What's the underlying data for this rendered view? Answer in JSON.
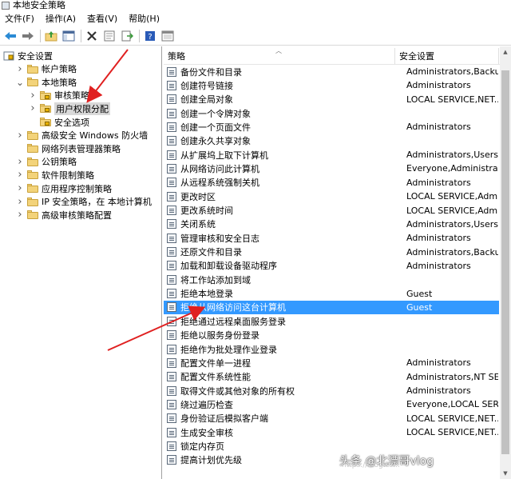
{
  "window": {
    "title": "本地安全策略"
  },
  "menu": [
    {
      "label": "文件(F)"
    },
    {
      "label": "操作(A)"
    },
    {
      "label": "查看(V)"
    },
    {
      "label": "帮助(H)"
    }
  ],
  "toolbar": [
    {
      "icon": "back-arrow-icon"
    },
    {
      "icon": "forward-arrow-icon"
    },
    {
      "icon": "up-folder-icon"
    },
    {
      "icon": "show-tree-icon"
    },
    {
      "icon": "delete-icon"
    },
    {
      "icon": "properties-icon"
    },
    {
      "icon": "export-icon"
    },
    {
      "icon": "help-icon"
    },
    {
      "icon": "console-view-icon"
    }
  ],
  "tree": [
    {
      "label": "安全设置",
      "level": 0,
      "expander": "",
      "selected": false
    },
    {
      "label": "帐户策略",
      "level": 1,
      "expander": ">",
      "selected": false
    },
    {
      "label": "本地策略",
      "level": 1,
      "expander": "v",
      "selected": false
    },
    {
      "label": "审核策略",
      "level": 2,
      "expander": ">",
      "selected": false
    },
    {
      "label": "用户权限分配",
      "level": 2,
      "expander": ">",
      "selected": true
    },
    {
      "label": "安全选项",
      "level": 2,
      "expander": "",
      "selected": false
    },
    {
      "label": "高级安全 Windows 防火墙",
      "level": 1,
      "expander": ">",
      "selected": false
    },
    {
      "label": "网络列表管理器策略",
      "level": 1,
      "expander": "",
      "selected": false
    },
    {
      "label": "公钥策略",
      "level": 1,
      "expander": ">",
      "selected": false
    },
    {
      "label": "软件限制策略",
      "level": 1,
      "expander": ">",
      "selected": false
    },
    {
      "label": "应用程序控制策略",
      "level": 1,
      "expander": ">",
      "selected": false
    },
    {
      "label": "IP 安全策略，在 本地计算机",
      "level": 1,
      "expander": ">",
      "selected": false
    },
    {
      "label": "高级审核策略配置",
      "level": 1,
      "expander": ">",
      "selected": false
    }
  ],
  "list": {
    "columns": [
      "策略",
      "安全设置"
    ],
    "rows": [
      {
        "name": "备份文件和目录",
        "setting": "Administrators,Backu..."
      },
      {
        "name": "创建符号链接",
        "setting": "Administrators"
      },
      {
        "name": "创建全局对象",
        "setting": "LOCAL SERVICE,NET..."
      },
      {
        "name": "创建一个令牌对象",
        "setting": ""
      },
      {
        "name": "创建一个页面文件",
        "setting": "Administrators"
      },
      {
        "name": "创建永久共享对象",
        "setting": ""
      },
      {
        "name": "从扩展坞上取下计算机",
        "setting": "Administrators,Users"
      },
      {
        "name": "从网络访问此计算机",
        "setting": "Everyone,Administrat..."
      },
      {
        "name": "从远程系统强制关机",
        "setting": "Administrators"
      },
      {
        "name": "更改时区",
        "setting": "LOCAL SERVICE,Admi..."
      },
      {
        "name": "更改系统时间",
        "setting": "LOCAL SERVICE,Admi..."
      },
      {
        "name": "关闭系统",
        "setting": "Administrators,Users,..."
      },
      {
        "name": "管理审核和安全日志",
        "setting": "Administrators"
      },
      {
        "name": "还原文件和目录",
        "setting": "Administrators,Backu..."
      },
      {
        "name": "加载和卸载设备驱动程序",
        "setting": "Administrators"
      },
      {
        "name": "将工作站添加到域",
        "setting": ""
      },
      {
        "name": "拒绝本地登录",
        "setting": "Guest"
      },
      {
        "name": "拒绝从网络访问这台计算机",
        "setting": "Guest"
      },
      {
        "name": "拒绝通过远程桌面服务登录",
        "setting": ""
      },
      {
        "name": "拒绝以服务身份登录",
        "setting": ""
      },
      {
        "name": "拒绝作为批处理作业登录",
        "setting": ""
      },
      {
        "name": "配置文件单一进程",
        "setting": "Administrators"
      },
      {
        "name": "配置文件系统性能",
        "setting": "Administrators,NT SE..."
      },
      {
        "name": "取得文件或其他对象的所有权",
        "setting": "Administrators"
      },
      {
        "name": "绕过遍历检查",
        "setting": "Everyone,LOCAL SERV..."
      },
      {
        "name": "身份验证后模拟客户端",
        "setting": "LOCAL SERVICE,NET..."
      },
      {
        "name": "生成安全审核",
        "setting": "LOCAL SERVICE,NET..."
      },
      {
        "name": "锁定内存页",
        "setting": ""
      },
      {
        "name": "提高计划优先级",
        "setting": ""
      }
    ],
    "selected_index": 17
  },
  "colors": {
    "selection": "#3399ff",
    "annotation_arrow": "#e02020"
  },
  "watermark": {
    "text": "头条 @北漂哥vlog",
    "url": "https://blog.cs..."
  }
}
